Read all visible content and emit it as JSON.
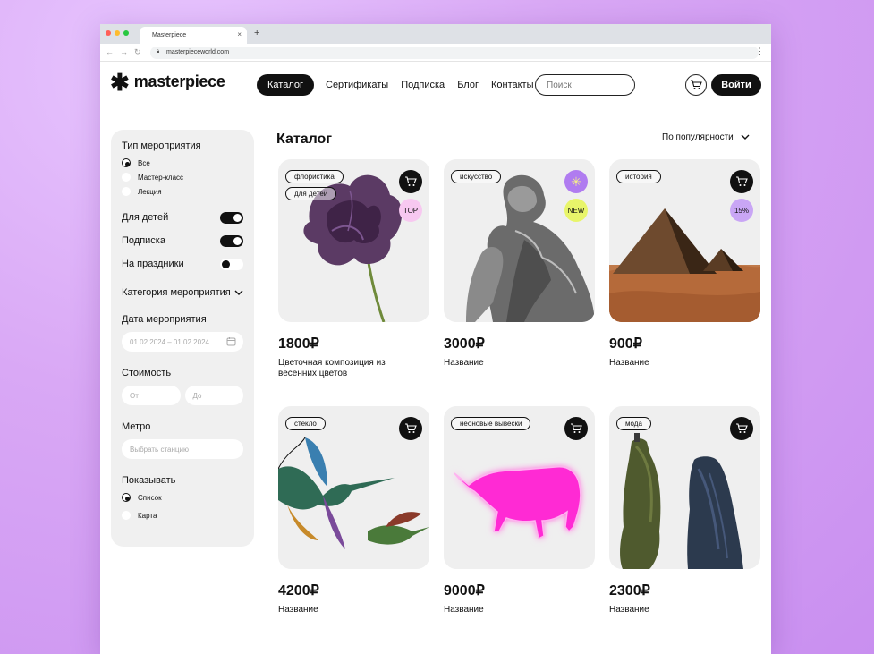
{
  "browser": {
    "tab_title": "Masterpiece",
    "tab_close": "×",
    "new_tab": "+",
    "url": "masterpieceworld.com",
    "back": "←",
    "forward": "→",
    "reload": "↻",
    "menu": "⋮",
    "colors": {
      "red": "#ff5f57",
      "yellow": "#febc2e",
      "green": "#28c840"
    }
  },
  "header": {
    "logo_mark": "✱",
    "logo_text": "masterpiece",
    "nav": [
      "Каталог",
      "Сертификаты",
      "Подписка",
      "Блог",
      "Контакты"
    ],
    "search_placeholder": "Поиск",
    "login": "Войти",
    "cart_icon": "cart-icon"
  },
  "sidebar": {
    "event_type_title": "Тип мероприятия",
    "event_types": [
      {
        "label": "Все",
        "selected": true
      },
      {
        "label": "Мастер-класс",
        "selected": false
      },
      {
        "label": "Лекция",
        "selected": false
      }
    ],
    "toggles": [
      {
        "label": "Для детей",
        "on": true
      },
      {
        "label": "Подписка",
        "on": true
      },
      {
        "label": "На праздники",
        "on": false
      }
    ],
    "category_label": "Категория мероприятия",
    "date_title": "Дата мероприятия",
    "date_value": "01.02.2024 – 01.02.2024",
    "cost_title": "Стоимость",
    "cost_from": "От",
    "cost_to": "До",
    "metro_title": "Метро",
    "metro_placeholder": "Выбрать станцию",
    "show_title": "Показывать",
    "show_options": [
      {
        "label": "Список",
        "selected": true
      },
      {
        "label": "Карта",
        "selected": false
      }
    ]
  },
  "main": {
    "title": "Каталог",
    "sort_label": "По популярности",
    "cards": [
      {
        "tags": [
          "флористика",
          "для детей"
        ],
        "badge": "TOP",
        "badge_color": "#f7c8f0",
        "price": "1800₽",
        "name": "Цветочная композиция из весенних цветов",
        "image": "purple-flower"
      },
      {
        "tags": [
          "искусство"
        ],
        "badge": "NEW",
        "badge_color": "#e8f56a",
        "top_icon": "✳",
        "top_icon_color": "#b07cf0",
        "price": "3000₽",
        "name": "Название",
        "image": "statue"
      },
      {
        "tags": [
          "история"
        ],
        "badge": "15%",
        "badge_color": "#c9a6f5",
        "price": "900₽",
        "name": "Название",
        "image": "pyramid"
      },
      {
        "tags": [
          "стекло"
        ],
        "badge": "",
        "price": "4200₽",
        "name": "Название",
        "image": "hummingbirds"
      },
      {
        "tags": [
          "неоновые вывески"
        ],
        "badge": "",
        "price": "9000₽",
        "name": "Название",
        "image": "neon-bull"
      },
      {
        "tags": [
          "мода"
        ],
        "badge": "",
        "price": "2300₽",
        "name": "Название",
        "image": "mannequins"
      }
    ]
  }
}
